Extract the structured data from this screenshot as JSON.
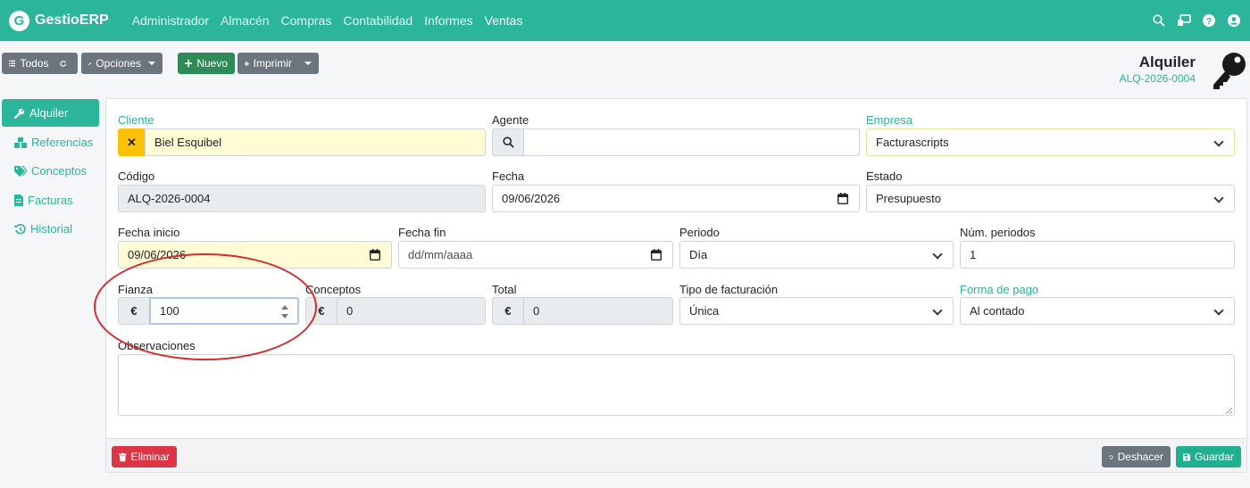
{
  "navbar": {
    "brand_letter": "G",
    "brand": "GestioERP",
    "links": [
      "Administrador",
      "Almacén",
      "Compras",
      "Contabilidad",
      "Informes",
      "Ventas"
    ],
    "icons": [
      "search-icon",
      "desktop-icon",
      "help-icon",
      "user-icon"
    ]
  },
  "toolbar": {
    "todos": "Todos",
    "opciones": "Opciones",
    "nuevo": "Nuevo",
    "imprimir": "Imprimir"
  },
  "doc": {
    "title": "Alquiler",
    "code": "ALQ-2026-0004"
  },
  "sidebar": {
    "items": [
      {
        "label": "Alquiler",
        "icon": "wrench-icon",
        "active": true
      },
      {
        "label": "Referencias",
        "icon": "cubes-icon"
      },
      {
        "label": "Conceptos",
        "icon": "tags-icon"
      },
      {
        "label": "Facturas",
        "icon": "file-invoice-icon"
      },
      {
        "label": "Historial",
        "icon": "history-icon"
      }
    ]
  },
  "form": {
    "cliente": {
      "label": "Cliente",
      "value": "Biel Esquibel",
      "clear": "✕"
    },
    "agente": {
      "label": "Agente",
      "value": ""
    },
    "empresa": {
      "label": "Empresa",
      "value": "Facturascripts"
    },
    "codigo": {
      "label": "Código",
      "value": "ALQ-2026-0004"
    },
    "fecha": {
      "label": "Fecha",
      "value": "09/06/2026"
    },
    "estado": {
      "label": "Estado",
      "value": "Presupuesto"
    },
    "fecha_inicio": {
      "label": "Fecha inicio",
      "value": "09/06/2026"
    },
    "fecha_fin": {
      "label": "Fecha fin",
      "placeholder": "dd/mm/aaaa"
    },
    "periodo": {
      "label": "Periodo",
      "value": "Día"
    },
    "num_periodos": {
      "label": "Núm. periodos",
      "value": "1"
    },
    "fianza": {
      "label": "Fianza",
      "currency": "€",
      "value": "100"
    },
    "conceptos": {
      "label": "Conceptos",
      "currency": "€",
      "value": "0"
    },
    "total": {
      "label": "Total",
      "currency": "€",
      "value": "0"
    },
    "tipo_facturacion": {
      "label": "Tipo de facturación",
      "value": "Única"
    },
    "forma_pago": {
      "label": "Forma de pago",
      "value": "Al contado"
    },
    "observaciones": {
      "label": "Observaciones",
      "value": ""
    }
  },
  "footer": {
    "eliminar": "Eliminar",
    "deshacer": "Deshacer",
    "guardar": "Guardar"
  },
  "colors": {
    "primary": "#2bb59a",
    "danger": "#dc3545",
    "success": "#2e8b57",
    "annotation": "#d42c2c"
  }
}
